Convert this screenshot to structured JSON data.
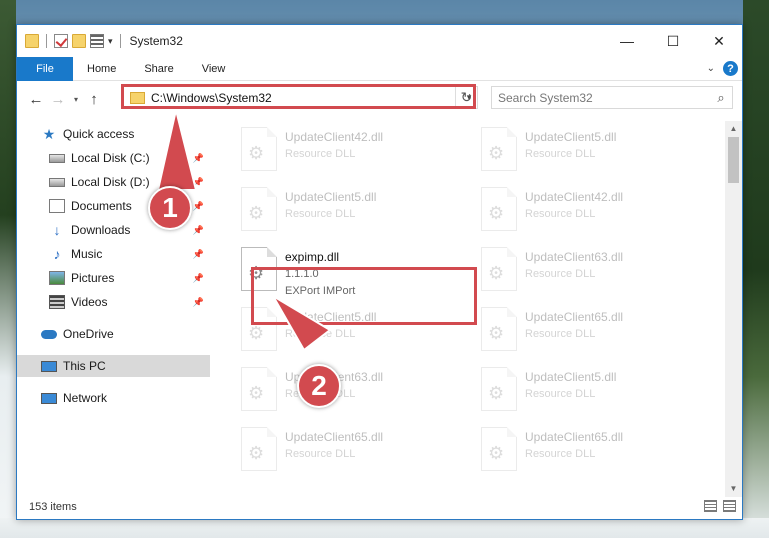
{
  "window": {
    "title": "System32"
  },
  "ribbon": {
    "tabs": [
      "File",
      "Home",
      "Share",
      "View"
    ]
  },
  "address": {
    "path": "C:\\Windows\\System32"
  },
  "search": {
    "placeholder": "Search System32"
  },
  "sidebar": {
    "items": [
      {
        "label": "Quick access",
        "icon": "star-icon"
      },
      {
        "label": "Local Disk (C:)",
        "icon": "disk-icon"
      },
      {
        "label": "Local Disk (D:)",
        "icon": "disk-icon"
      },
      {
        "label": "Documents",
        "icon": "document-icon"
      },
      {
        "label": "Downloads",
        "icon": "download-icon"
      },
      {
        "label": "Music",
        "icon": "music-icon"
      },
      {
        "label": "Pictures",
        "icon": "pictures-icon"
      },
      {
        "label": "Videos",
        "icon": "videos-icon"
      },
      {
        "label": "OneDrive",
        "icon": "cloud-icon"
      },
      {
        "label": "This PC",
        "icon": "computer-icon"
      },
      {
        "label": "Network",
        "icon": "network-icon"
      }
    ]
  },
  "files": [
    {
      "name": "UpdateClient42.dll",
      "type": "Resource DLL"
    },
    {
      "name": "UpdateClient5.dll",
      "type": "Resource DLL"
    },
    {
      "name": "UpdateClient5.dll",
      "type": "Resource DLL"
    },
    {
      "name": "UpdateClient42.dll",
      "type": "Resource DLL"
    },
    {
      "name": "expimp.dll",
      "version": "1.1.1.0",
      "description": "EXPort IMPort"
    },
    {
      "name": "UpdateClient63.dll",
      "type": "Resource DLL"
    },
    {
      "name": "UpdateClient5.dll",
      "type": "Resource DLL"
    },
    {
      "name": "UpdateClient65.dll",
      "type": "Resource DLL"
    },
    {
      "name": "UpdateClient63.dll",
      "type": "Resource DLL"
    },
    {
      "name": "UpdateClient5.dll",
      "type": "Resource DLL"
    },
    {
      "name": "UpdateClient65.dll",
      "type": "Resource DLL"
    },
    {
      "name": "UpdateClient65.dll",
      "type": "Resource DLL"
    }
  ],
  "status": {
    "count": "153 items"
  },
  "annotations": {
    "marker1": "1",
    "marker2": "2"
  },
  "colors": {
    "accent": "#1979ca",
    "highlight": "#d24a4f"
  }
}
